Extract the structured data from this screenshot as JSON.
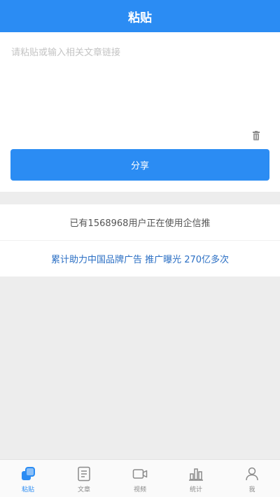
{
  "header": {
    "title": "粘贴"
  },
  "paste": {
    "placeholder": "请粘贴或输入相关文章链接",
    "share_label": "分享"
  },
  "stats": {
    "users_text": "已有1568968用户正在使用企信推",
    "ads_text": "累计助力中国品牌广告 推广曝光 270亿多次"
  },
  "tabs": [
    {
      "label": "粘贴",
      "icon": "paste-icon",
      "active": true
    },
    {
      "label": "文章",
      "icon": "article-icon",
      "active": false
    },
    {
      "label": "视频",
      "icon": "video-icon",
      "active": false
    },
    {
      "label": "统计",
      "icon": "stats-icon",
      "active": false
    },
    {
      "label": "我",
      "icon": "profile-icon",
      "active": false
    }
  ],
  "colors": {
    "accent": "#2b8cf3",
    "link": "#2b6fc4",
    "background": "#ededed"
  }
}
